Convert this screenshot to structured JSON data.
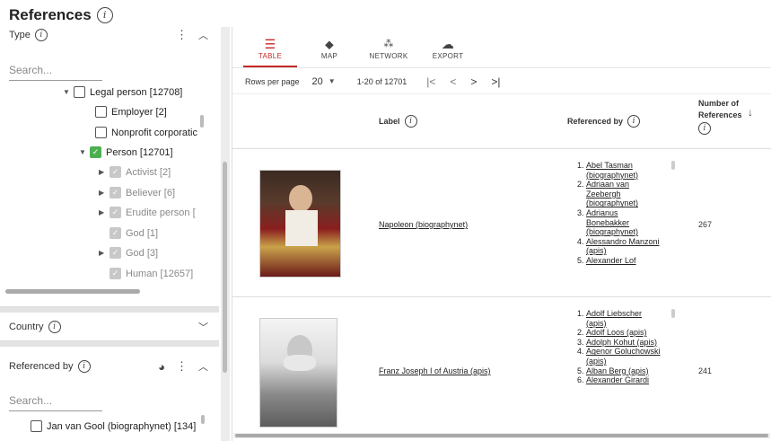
{
  "page": {
    "title": "References"
  },
  "type_panel": {
    "title": "Type",
    "search_placeholder": "Search...",
    "nodes": [
      {
        "label": "Legal person [12708]"
      },
      {
        "label": "Employer [2]"
      },
      {
        "label": "Nonprofit corporatic"
      },
      {
        "label": "Person [12701]"
      },
      {
        "label": "Activist [2]"
      },
      {
        "label": "Believer [6]"
      },
      {
        "label": "Erudite person ["
      },
      {
        "label": "God [1]"
      },
      {
        "label": "God [3]"
      },
      {
        "label": "Human [12657]"
      }
    ]
  },
  "country_panel": {
    "title": "Country"
  },
  "referenced_panel": {
    "title": "Referenced by",
    "search_placeholder": "Search...",
    "first_item": "Jan van Gool (biographynet) [134]"
  },
  "tabs": [
    {
      "label": "TABLE",
      "icon": "table-icon"
    },
    {
      "label": "MAP",
      "icon": "map-pin-icon"
    },
    {
      "label": "NETWORK",
      "icon": "network-icon"
    },
    {
      "label": "EXPORT",
      "icon": "cloud-download-icon"
    }
  ],
  "pager": {
    "rows_label": "Rows per page",
    "rows_value": "20",
    "range": "1-20 of 12701"
  },
  "columns": {
    "label": "Label",
    "referenced_by": "Referenced by",
    "number_line1": "Number of",
    "number_line2": "References"
  },
  "rows": [
    {
      "label": "Napoleon (biographynet)",
      "count": "267",
      "refs": [
        "Abel Tasman (biographynet)",
        "Adriaan van Zeebergh (biographynet)",
        "Adrianus Bonebakker (biographynet)",
        "Alessandro Manzoni (apis)",
        "Alexander Lof"
      ]
    },
    {
      "label": "Franz Joseph I of Austria (apis)",
      "count": "241",
      "refs": [
        "Adolf Liebscher (apis)",
        "Adolf Loos (apis)",
        "Adolph Kohut (apis)",
        "Agenor Goluchowski (apis)",
        "Alban Berg (apis)",
        "Alexander Girardi"
      ]
    }
  ],
  "colors": {
    "accent": "#c62828",
    "check": "#4caf50"
  }
}
